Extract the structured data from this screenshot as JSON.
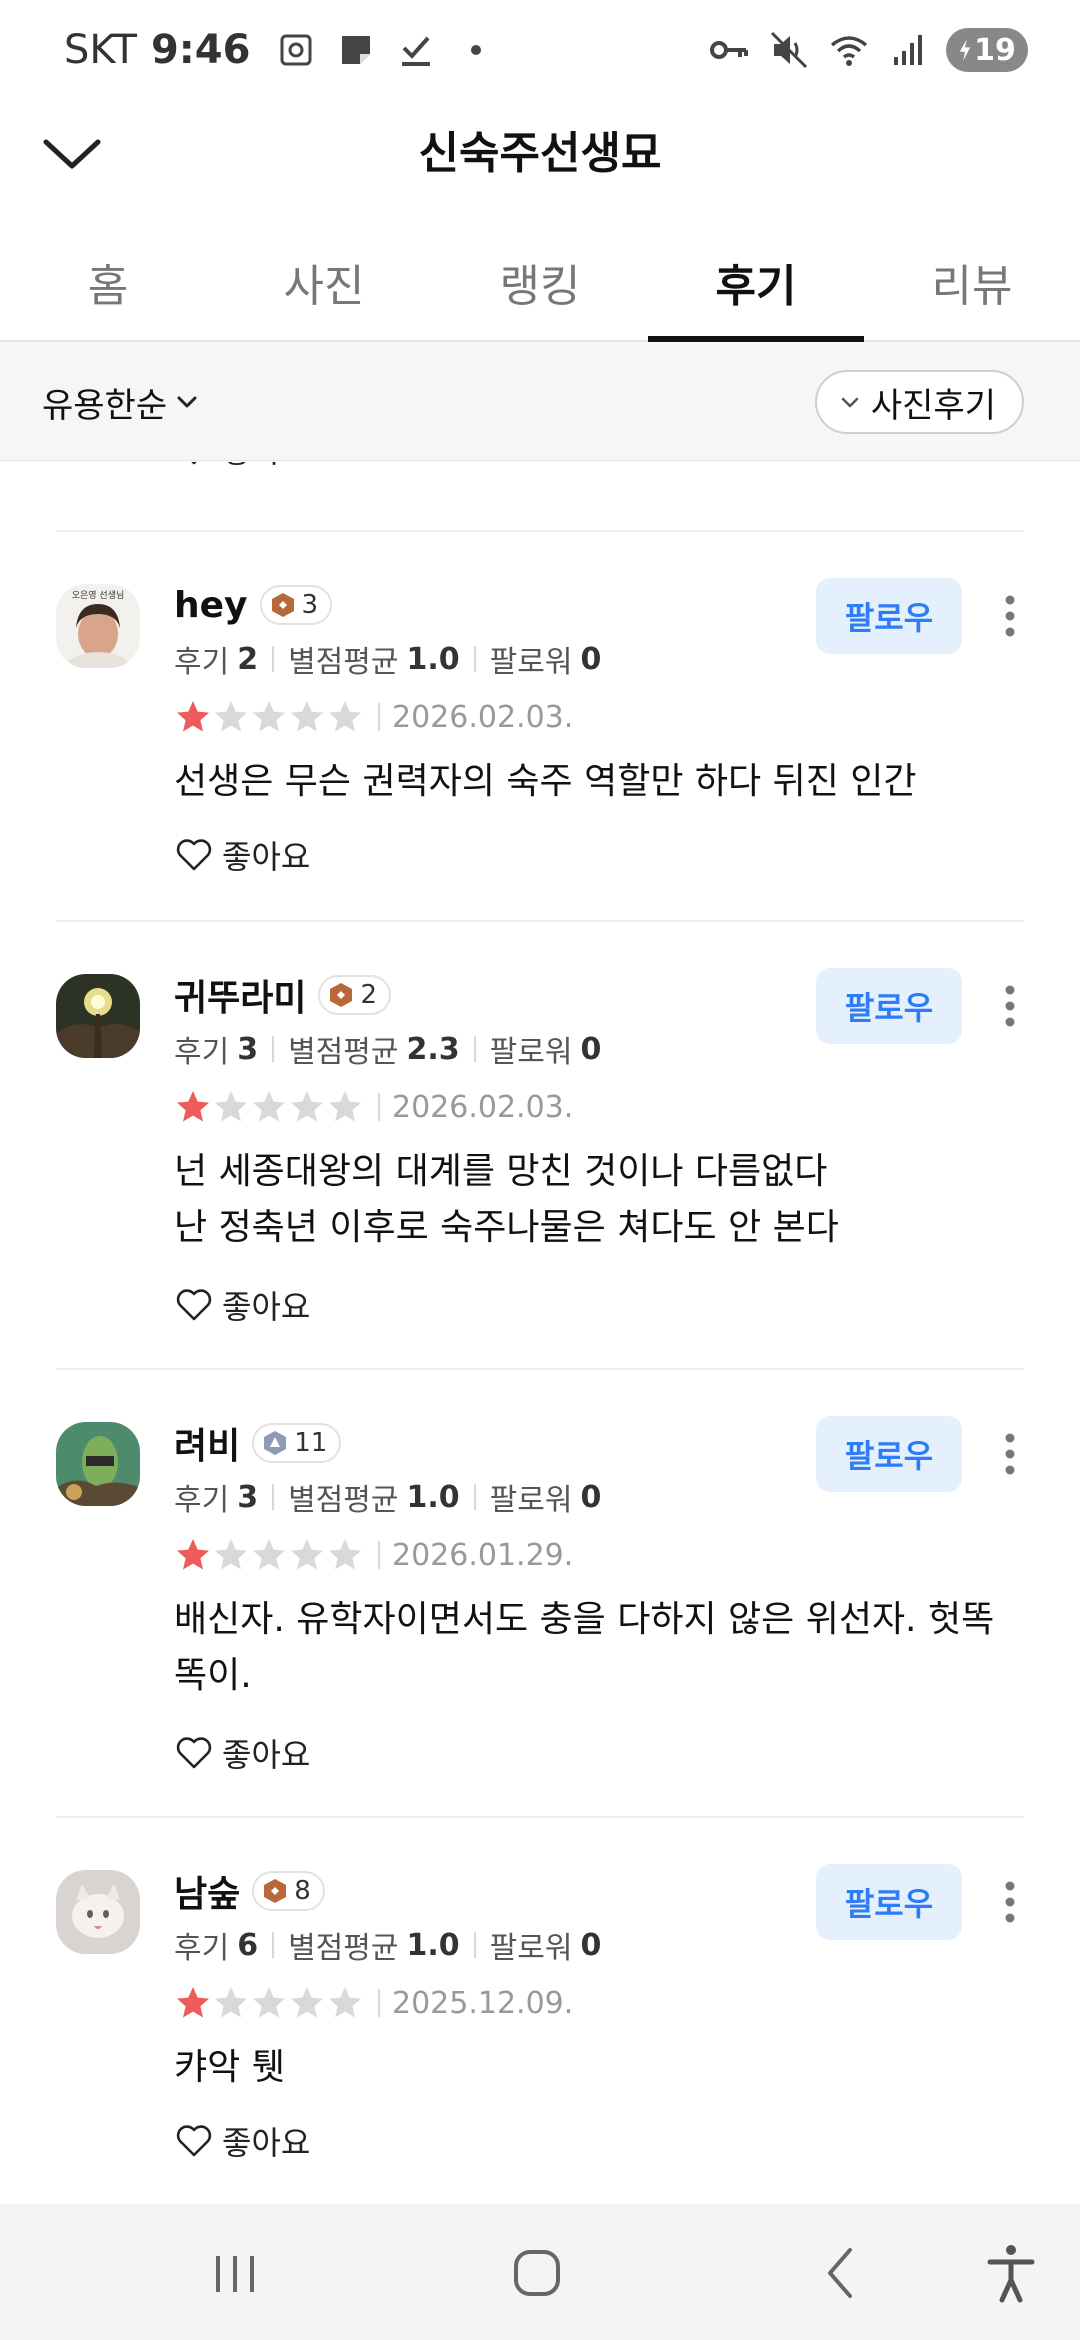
{
  "status_bar": {
    "carrier": "SKT",
    "time": "9:46",
    "battery": "19"
  },
  "header": {
    "title": "신숙주선생묘"
  },
  "tabs": [
    {
      "label": "홈",
      "active": false
    },
    {
      "label": "사진",
      "active": false
    },
    {
      "label": "랭킹",
      "active": false
    },
    {
      "label": "후기",
      "active": true
    },
    {
      "label": "리뷰",
      "active": false
    }
  ],
  "filter": {
    "sort_label": "유용한순",
    "photo_filter_label": "사진후기"
  },
  "labels": {
    "reviews": "후기",
    "avg_rating": "별점평균",
    "followers": "팔로워",
    "like": "좋아요",
    "follow": "팔로우"
  },
  "reviews": [
    {
      "name": "hey",
      "level": "3",
      "review_count": "2",
      "avg_rating": "1.0",
      "followers": "0",
      "stars": 1,
      "date": "2026.02.03.",
      "text": "선생은 무슨 권력자의 숙주 역할만 하다 뒤진 인간",
      "avatar_caption": "오은영 선생님"
    },
    {
      "name": "귀뚜라미",
      "level": "2",
      "review_count": "3",
      "avg_rating": "2.3",
      "followers": "0",
      "stars": 1,
      "date": "2026.02.03.",
      "text": "넌 세종대왕의 대계를 망친 것이나 다름없다\n난 정축년 이후로 숙주나물은 쳐다도 안 본다"
    },
    {
      "name": "려비",
      "level": "11",
      "review_count": "3",
      "avg_rating": "1.0",
      "followers": "0",
      "stars": 1,
      "date": "2026.01.29.",
      "text": "배신자. 유학자이면서도 충을 다하지 않은 위선자. 헛똑똑이."
    },
    {
      "name": "남숲",
      "level": "8",
      "review_count": "6",
      "avg_rating": "1.0",
      "followers": "0",
      "stars": 1,
      "date": "2025.12.09.",
      "text": "캬악 퉷"
    }
  ],
  "colors": {
    "star_filled": "#ef5a5a",
    "star_empty": "#d9d9d9",
    "follow_bg": "#e5f0fd",
    "follow_text": "#2f7cf6",
    "badge_bronze": "#b8683b",
    "badge_silver": "#8e9bb4"
  }
}
